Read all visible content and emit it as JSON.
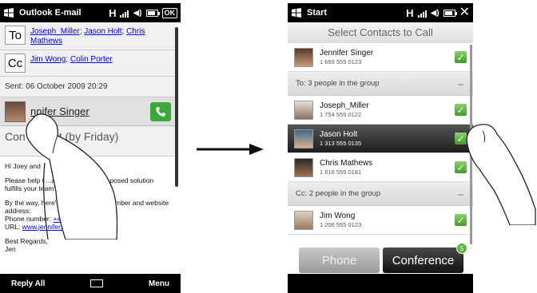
{
  "left_phone": {
    "status": {
      "app_title": "Outlook E-mail",
      "ok": "OK"
    },
    "to_label": "To",
    "to_recipients": [
      "Joseph_Miller",
      "Jason Holt",
      "Chris Mathews"
    ],
    "cc_label": "Cc",
    "cc_recipients": [
      "Jim Wong",
      "Colin Porter"
    ],
    "sent": "Sent: 06 October 2009 20:29",
    "sender": "Jennifer Singer",
    "sender_display": "nnifer Singer",
    "subject_visible": "Con       equest (by Friday)",
    "body": {
      "greeting": "Hi Joey and",
      "p1": "Please help t      ...ain whether the proposed solution fulfills your team's requirement,",
      "p2a": "By the way, here's my new phone number and website address:",
      "phone_label": "Phone number: ",
      "phone": "+44 1111 11111",
      "url_label": "URL: ",
      "url": "www.jennifer.singer.com",
      "closing": "Best Regards,",
      "sign": "Jen"
    },
    "softkeys": {
      "left": "Reply All",
      "right": "Menu"
    }
  },
  "right_phone": {
    "status": {
      "app_title": "Start"
    },
    "header": "Select Contacts to Call",
    "contacts_top": [
      {
        "name": "Jennifer Singer",
        "phone": "1 669 555 0123",
        "checked": true
      }
    ],
    "group_to": "To: 3 people in the group",
    "contacts_to": [
      {
        "name": "Joseph_Miller",
        "phone": "1 754 555 0122",
        "checked": true
      },
      {
        "name": "Jason Holt",
        "phone": "1 313 555 0135",
        "checked": true,
        "selected": true
      },
      {
        "name": "Chris Mathews",
        "phone": "1 616 555 0181",
        "checked": true
      }
    ],
    "group_cc": "Cc: 2 people in the group",
    "contacts_cc": [
      {
        "name": "Jim Wong",
        "phone": "1 206 555 0123",
        "checked": true
      }
    ],
    "buttons": {
      "phone": "Phone",
      "conference": "Conference",
      "badge": "5"
    }
  }
}
